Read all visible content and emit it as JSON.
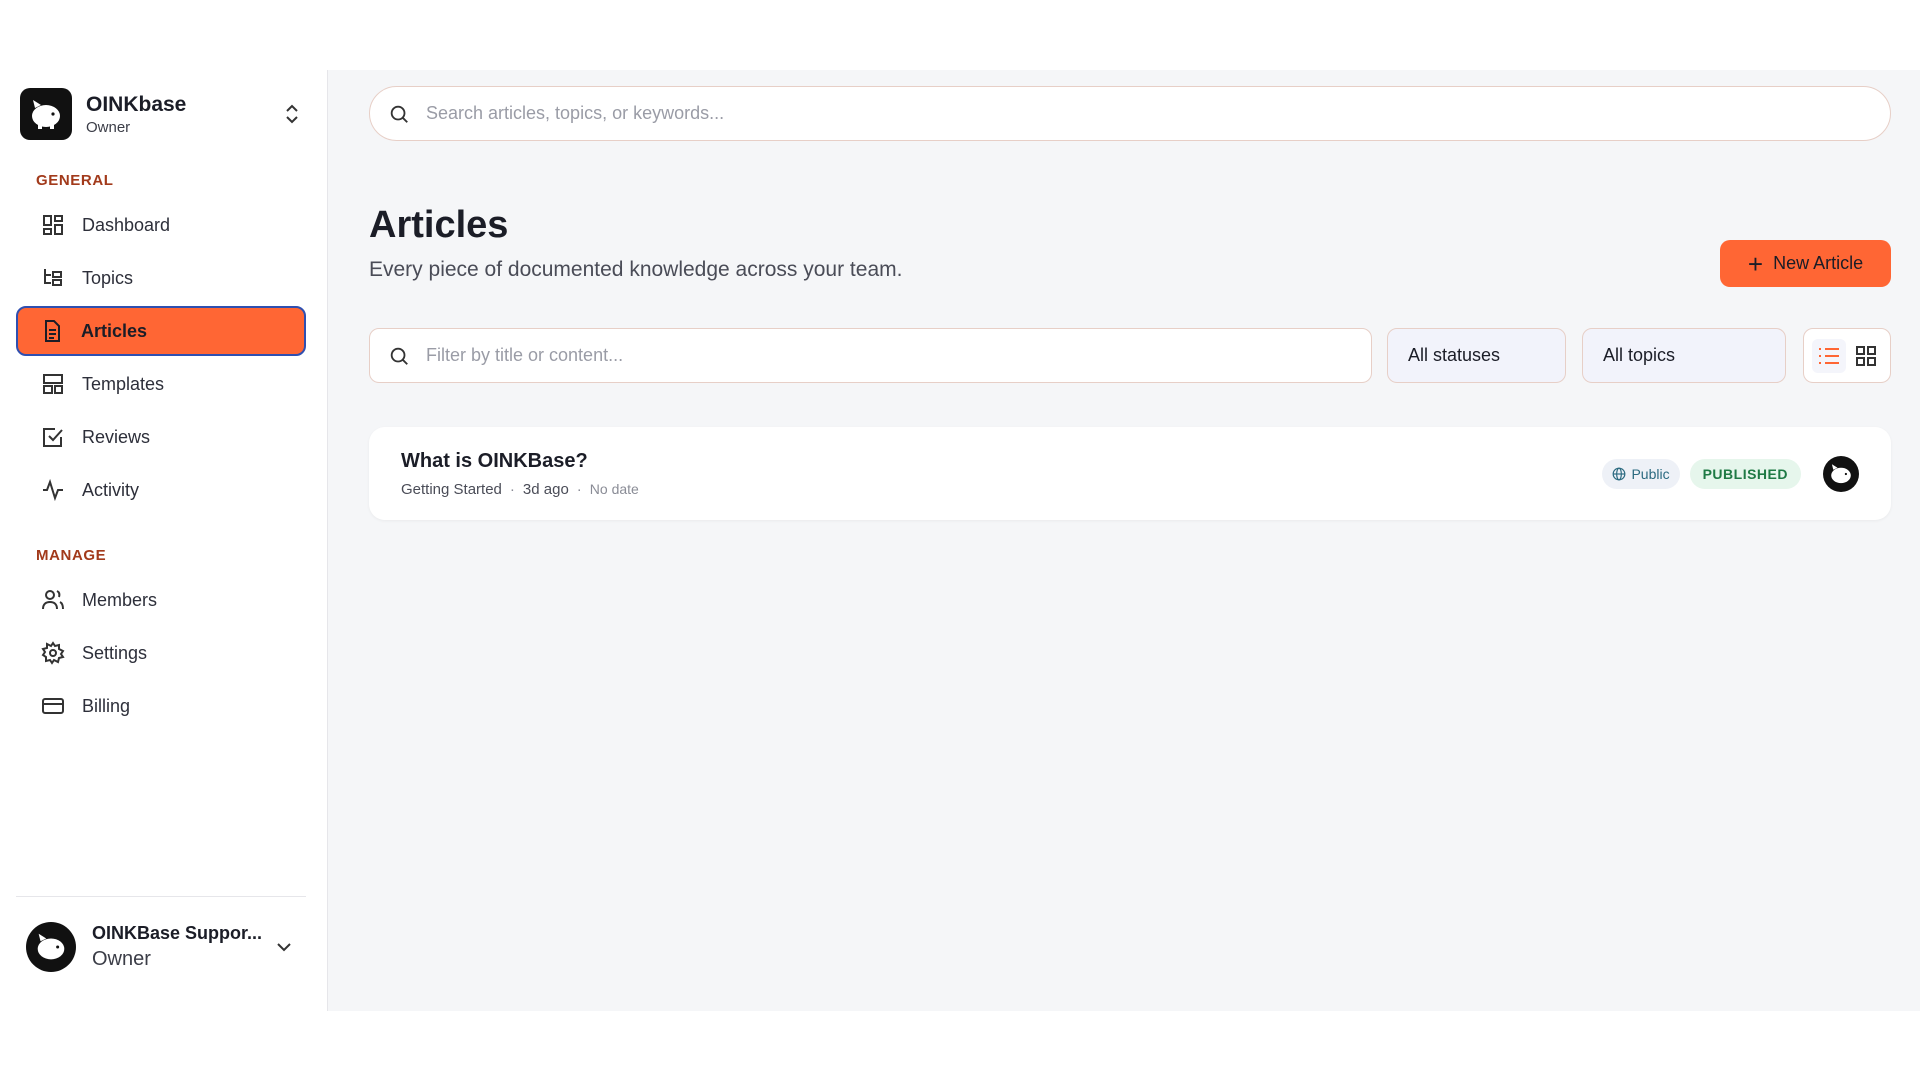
{
  "workspace": {
    "name": "OINKbase",
    "role": "Owner"
  },
  "sidebar": {
    "general_title": "GENERAL",
    "general_items": [
      {
        "label": "Dashboard",
        "icon": "dashboard-icon"
      },
      {
        "label": "Topics",
        "icon": "topics-icon"
      },
      {
        "label": "Articles",
        "icon": "articles-icon",
        "active": true
      },
      {
        "label": "Templates",
        "icon": "templates-icon"
      },
      {
        "label": "Reviews",
        "icon": "reviews-icon"
      },
      {
        "label": "Activity",
        "icon": "activity-icon"
      }
    ],
    "manage_title": "MANAGE",
    "manage_items": [
      {
        "label": "Members",
        "icon": "members-icon"
      },
      {
        "label": "Settings",
        "icon": "settings-icon"
      },
      {
        "label": "Billing",
        "icon": "billing-icon"
      }
    ]
  },
  "user": {
    "name": "OINKBase Suppor...",
    "role": "Owner"
  },
  "search": {
    "placeholder": "Search articles, topics, or keywords..."
  },
  "page": {
    "title": "Articles",
    "subtitle": "Every piece of documented knowledge across your team.",
    "new_button": "New Article"
  },
  "filters": {
    "placeholder": "Filter by title or content...",
    "status": "All statuses",
    "topic": "All topics"
  },
  "articles": [
    {
      "title": "What is OINKBase?",
      "topic": "Getting Started",
      "updated": "3d ago",
      "date": "No date",
      "visibility": "Public",
      "status": "PUBLISHED"
    }
  ],
  "colors": {
    "accent": "#ff6634",
    "section_title": "#a23a1b",
    "published": "#1f7a45"
  }
}
